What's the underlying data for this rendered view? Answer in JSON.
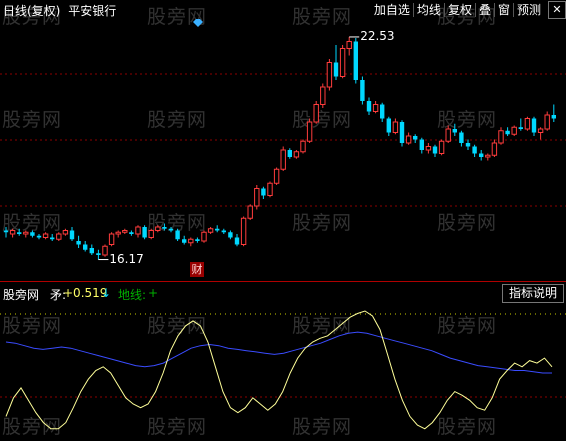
{
  "window": {
    "period": "日线(复权)",
    "stock_name": "平安银行"
  },
  "toolbar": {
    "items": [
      "加自选",
      "均线",
      "复权",
      "叠",
      "窗",
      "预测"
    ],
    "close_label": "✕"
  },
  "price_chart": {
    "high_label": "22.53",
    "low_label": "16.17",
    "event_marker": "财",
    "candle_colors": {
      "up": "#ff3c3c",
      "down": "#00d8ff"
    },
    "candles": [
      [
        17.0,
        17.1,
        16.8,
        16.95
      ],
      [
        16.9,
        17.05,
        16.8,
        17.0
      ],
      [
        16.95,
        17.05,
        16.85,
        16.9
      ],
      [
        16.9,
        17.0,
        16.8,
        16.95
      ],
      [
        16.95,
        17.0,
        16.8,
        16.85
      ],
      [
        16.85,
        16.9,
        16.75,
        16.8
      ],
      [
        16.8,
        16.95,
        16.75,
        16.9
      ],
      [
        16.8,
        16.9,
        16.7,
        16.75
      ],
      [
        16.75,
        16.95,
        16.7,
        16.9
      ],
      [
        16.9,
        17.05,
        16.85,
        17.0
      ],
      [
        17.0,
        17.1,
        16.7,
        16.75
      ],
      [
        16.7,
        16.85,
        16.5,
        16.6
      ],
      [
        16.6,
        16.7,
        16.4,
        16.45
      ],
      [
        16.5,
        16.6,
        16.3,
        16.35
      ],
      [
        16.35,
        16.45,
        16.17,
        16.3
      ],
      [
        16.3,
        16.6,
        16.25,
        16.55
      ],
      [
        16.6,
        16.95,
        16.55,
        16.9
      ],
      [
        16.9,
        17.0,
        16.8,
        16.95
      ],
      [
        16.95,
        17.05,
        16.9,
        17.0
      ],
      [
        16.95,
        17.0,
        16.85,
        16.9
      ],
      [
        16.9,
        17.15,
        16.8,
        17.1
      ],
      [
        17.1,
        17.15,
        16.75,
        16.8
      ],
      [
        16.8,
        17.05,
        16.75,
        17.0
      ],
      [
        17.0,
        17.15,
        16.95,
        17.1
      ],
      [
        17.1,
        17.2,
        17.0,
        17.05
      ],
      [
        17.05,
        17.1,
        16.95,
        17.0
      ],
      [
        17.0,
        17.05,
        16.7,
        16.75
      ],
      [
        16.75,
        16.85,
        16.6,
        16.65
      ],
      [
        16.65,
        16.8,
        16.55,
        16.75
      ],
      [
        16.75,
        16.8,
        16.65,
        16.7
      ],
      [
        16.7,
        17.0,
        16.65,
        16.95
      ],
      [
        16.95,
        17.1,
        16.9,
        17.05
      ],
      [
        17.05,
        17.15,
        16.95,
        17.0
      ],
      [
        17.0,
        17.05,
        16.9,
        16.95
      ],
      [
        16.95,
        17.0,
        16.75,
        16.8
      ],
      [
        16.8,
        16.9,
        16.55,
        16.6
      ],
      [
        16.6,
        17.4,
        16.55,
        17.35
      ],
      [
        17.35,
        17.75,
        17.3,
        17.7
      ],
      [
        17.7,
        18.3,
        17.6,
        18.2
      ],
      [
        18.2,
        18.25,
        17.9,
        18.0
      ],
      [
        18.0,
        18.4,
        17.95,
        18.35
      ],
      [
        18.35,
        18.8,
        18.3,
        18.75
      ],
      [
        18.75,
        19.4,
        18.7,
        19.3
      ],
      [
        19.3,
        19.35,
        19.05,
        19.1
      ],
      [
        19.1,
        19.3,
        19.05,
        19.25
      ],
      [
        19.25,
        19.6,
        19.2,
        19.55
      ],
      [
        19.55,
        20.2,
        19.5,
        20.1
      ],
      [
        20.1,
        20.7,
        20.05,
        20.6
      ],
      [
        20.6,
        21.2,
        20.5,
        21.1
      ],
      [
        21.1,
        21.9,
        21.0,
        21.8
      ],
      [
        21.8,
        22.3,
        21.3,
        21.4
      ],
      [
        21.4,
        22.3,
        21.35,
        22.2
      ],
      [
        22.2,
        22.53,
        22.0,
        22.4
      ],
      [
        22.4,
        22.5,
        21.2,
        21.3
      ],
      [
        21.3,
        21.4,
        20.6,
        20.7
      ],
      [
        20.7,
        20.8,
        20.3,
        20.4
      ],
      [
        20.4,
        20.7,
        20.35,
        20.6
      ],
      [
        20.6,
        20.65,
        20.1,
        20.2
      ],
      [
        20.2,
        20.25,
        19.7,
        19.8
      ],
      [
        19.8,
        20.2,
        19.75,
        20.1
      ],
      [
        20.1,
        20.15,
        19.4,
        19.5
      ],
      [
        19.5,
        19.8,
        19.45,
        19.7
      ],
      [
        19.7,
        19.75,
        19.5,
        19.6
      ],
      [
        19.6,
        19.65,
        19.2,
        19.3
      ],
      [
        19.3,
        19.5,
        19.2,
        19.4
      ],
      [
        19.4,
        19.45,
        19.1,
        19.2
      ],
      [
        19.2,
        19.6,
        19.15,
        19.55
      ],
      [
        19.55,
        20.0,
        19.5,
        19.9
      ],
      [
        19.9,
        20.05,
        19.7,
        19.8
      ],
      [
        19.8,
        19.85,
        19.4,
        19.5
      ],
      [
        19.5,
        19.6,
        19.3,
        19.4
      ],
      [
        19.4,
        19.45,
        19.1,
        19.2
      ],
      [
        19.2,
        19.3,
        19.0,
        19.1
      ],
      [
        19.1,
        19.2,
        19.0,
        19.15
      ],
      [
        19.15,
        19.6,
        19.1,
        19.5
      ],
      [
        19.5,
        19.95,
        19.45,
        19.85
      ],
      [
        19.85,
        19.95,
        19.7,
        19.75
      ],
      [
        19.75,
        20.0,
        19.7,
        19.95
      ],
      [
        19.95,
        20.2,
        19.85,
        19.9
      ],
      [
        19.9,
        20.25,
        19.85,
        20.2
      ],
      [
        20.2,
        20.25,
        19.7,
        19.8
      ],
      [
        19.8,
        19.95,
        19.6,
        19.9
      ],
      [
        19.9,
        20.4,
        19.85,
        20.3
      ],
      [
        20.3,
        20.6,
        20.1,
        20.2
      ]
    ]
  },
  "indicator": {
    "name": "股旁网",
    "line1_label": "矛:",
    "line1_value": "+0.519",
    "line1_arrow": "↓",
    "line2_label": "地线:",
    "line2_value": "+",
    "button_label": "指标说明",
    "line1_color": "#ffff99",
    "line2_color": "#3a4cff",
    "yellow_series": [
      0.15,
      0.3,
      0.38,
      0.28,
      0.18,
      0.1,
      0.05,
      0.05,
      0.1,
      0.22,
      0.35,
      0.45,
      0.52,
      0.55,
      0.5,
      0.4,
      0.3,
      0.25,
      0.22,
      0.25,
      0.35,
      0.5,
      0.68,
      0.8,
      0.88,
      0.92,
      0.88,
      0.75,
      0.55,
      0.35,
      0.22,
      0.18,
      0.22,
      0.3,
      0.25,
      0.2,
      0.25,
      0.35,
      0.5,
      0.62,
      0.7,
      0.75,
      0.78,
      0.8,
      0.85,
      0.9,
      0.95,
      0.98,
      1.0,
      0.96,
      0.85,
      0.65,
      0.45,
      0.28,
      0.15,
      0.08,
      0.05,
      0.1,
      0.18,
      0.28,
      0.35,
      0.32,
      0.28,
      0.22,
      0.2,
      0.3,
      0.45,
      0.52,
      0.58,
      0.55,
      0.6,
      0.58,
      0.62,
      0.55
    ],
    "blue_series": [
      0.75,
      0.74,
      0.72,
      0.7,
      0.69,
      0.7,
      0.71,
      0.7,
      0.68,
      0.66,
      0.64,
      0.62,
      0.6,
      0.58,
      0.56,
      0.55,
      0.56,
      0.58,
      0.62,
      0.66,
      0.7,
      0.72,
      0.73,
      0.72,
      0.7,
      0.69,
      0.68,
      0.67,
      0.66,
      0.65,
      0.66,
      0.68,
      0.7,
      0.72,
      0.74,
      0.77,
      0.8,
      0.82,
      0.83,
      0.82,
      0.8,
      0.78,
      0.76,
      0.74,
      0.72,
      0.7,
      0.68,
      0.65,
      0.62,
      0.6,
      0.58,
      0.56,
      0.55,
      0.54,
      0.53,
      0.52,
      0.52,
      0.51,
      0.5,
      0.5
    ]
  },
  "watermarks": [
    "股旁网",
    "股旁网",
    "股旁网",
    "股旁网",
    "股旁网",
    "股旁网",
    "股旁网",
    "股旁网",
    "股旁网",
    "股旁网",
    "股旁网",
    "股旁网",
    "股旁网",
    "股旁网",
    "股旁网",
    "股旁网",
    "股旁网",
    "股旁网",
    "股旁网",
    "股旁网",
    "股旁网",
    "股旁网",
    "股旁网",
    "股旁网"
  ]
}
